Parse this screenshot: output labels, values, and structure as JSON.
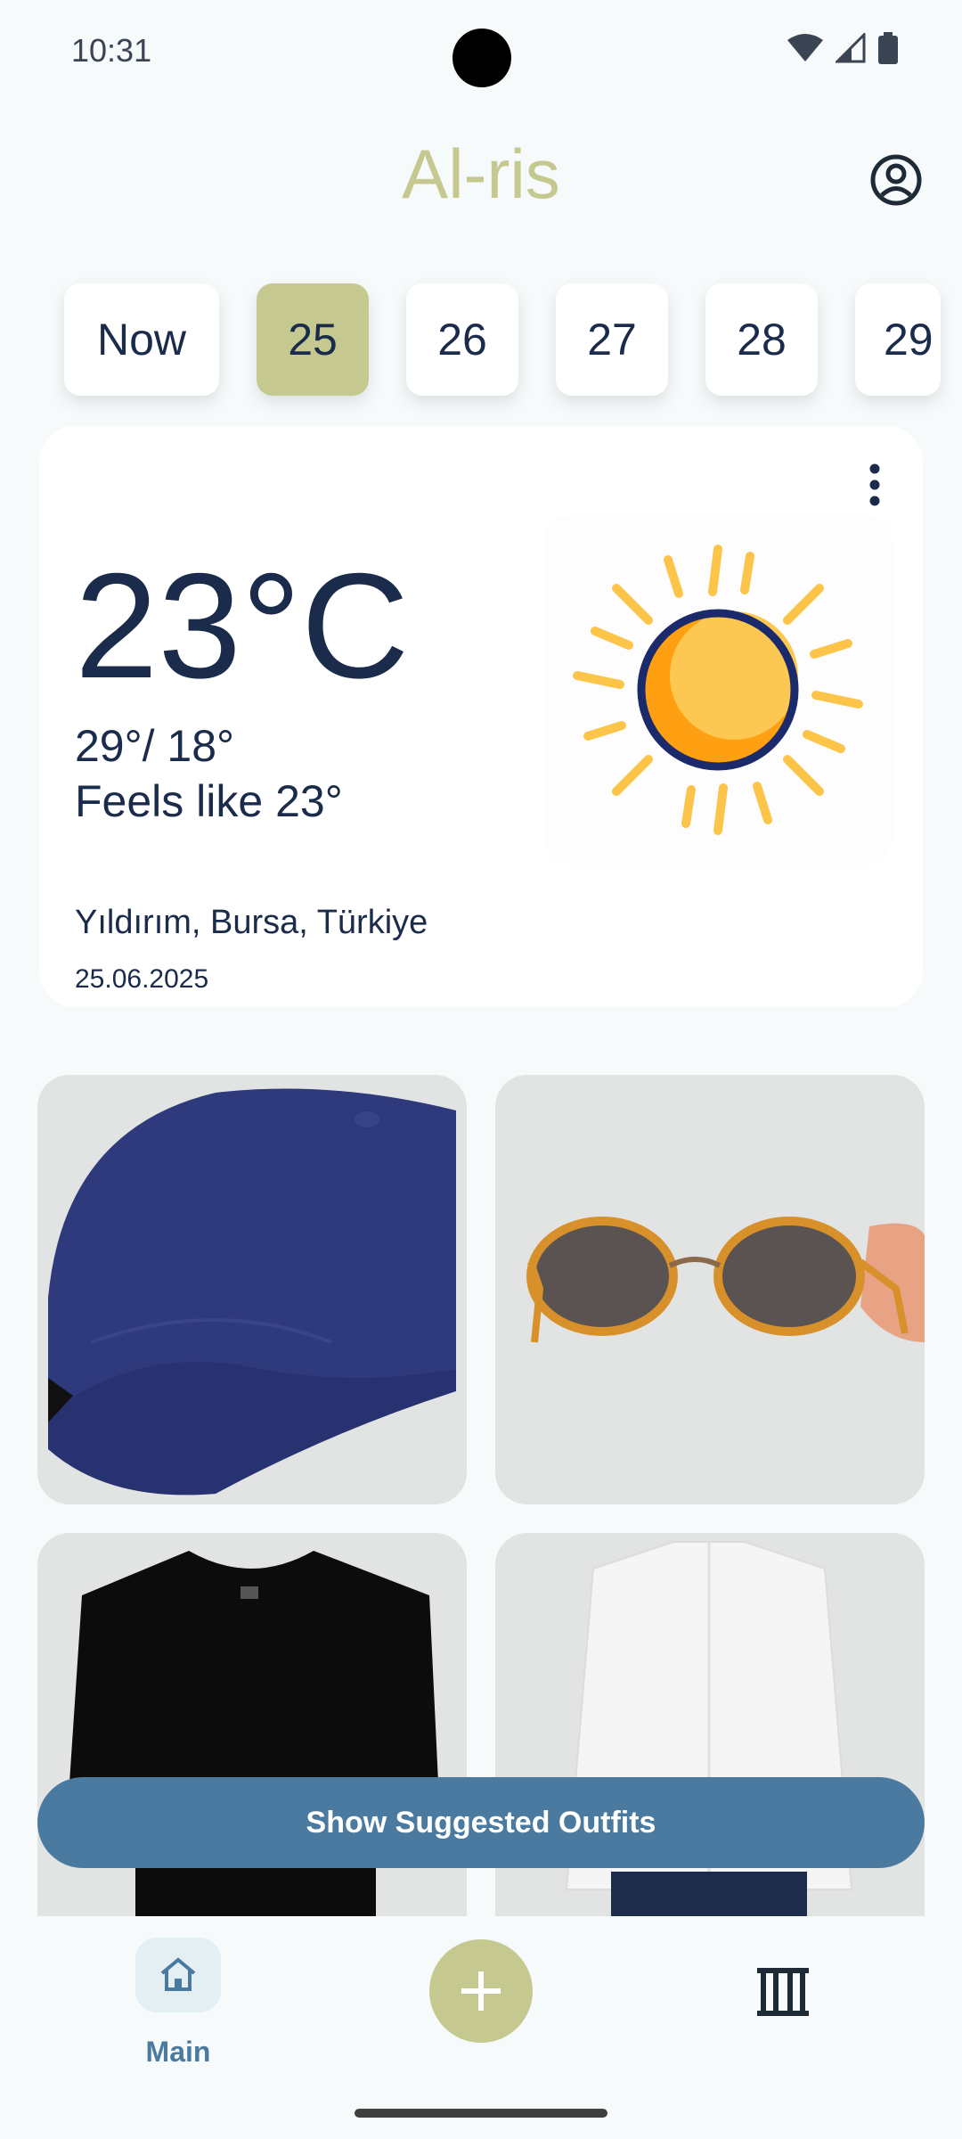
{
  "status_bar": {
    "time": "10:31"
  },
  "app": {
    "title": "Al-ris"
  },
  "days": [
    {
      "label": "Now",
      "selected": false
    },
    {
      "label": "25",
      "selected": true
    },
    {
      "label": "26",
      "selected": false
    },
    {
      "label": "27",
      "selected": false
    },
    {
      "label": "28",
      "selected": false
    },
    {
      "label": "29",
      "selected": false
    }
  ],
  "weather": {
    "temperature": "23°C",
    "high_low": "29°/ 18°",
    "feels_like": "Feels like 23°",
    "location": "Yıldırım, Bursa, Türkiye",
    "date": "25.06.2025",
    "condition_icon": "sun-icon"
  },
  "outfit_items": [
    {
      "name": "navy-baseball-cap"
    },
    {
      "name": "sunglasses"
    },
    {
      "name": "black-t-shirt"
    },
    {
      "name": "white-shirt"
    }
  ],
  "actions": {
    "suggest_label": "Show Suggested Outfits"
  },
  "nav": {
    "main_label": "Main"
  },
  "colors": {
    "accent": "#c5c98f",
    "primary": "#4a7a9f",
    "text": "#1b2b4b"
  }
}
